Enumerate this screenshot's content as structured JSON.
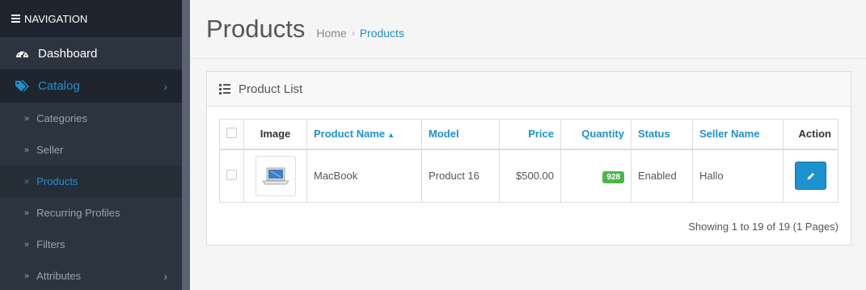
{
  "sidebar": {
    "header": "NAVIGATION",
    "dashboard": "Dashboard",
    "catalog": "Catalog",
    "items": [
      "Categories",
      "Seller",
      "Products",
      "Recurring Profiles",
      "Filters",
      "Attributes"
    ]
  },
  "header": {
    "title": "Products",
    "breadcrumb_home": "Home",
    "breadcrumb_current": "Products"
  },
  "panel": {
    "title": "Product List",
    "columns": {
      "image": "Image",
      "product_name": "Product Name",
      "model": "Model",
      "price": "Price",
      "quantity": "Quantity",
      "status": "Status",
      "seller_name": "Seller Name",
      "action": "Action"
    },
    "rows": [
      {
        "product_name": "MacBook",
        "model": "Product 16",
        "price": "$500.00",
        "quantity": "928",
        "status": "Enabled",
        "seller_name": "Hallo"
      }
    ],
    "pagination_text": "Showing 1 to 19 of 19 (1 Pages)"
  },
  "colors": {
    "accent": "#1e91cf",
    "sidebar_bg": "#2c343f",
    "quantity_badge": "#4cb64c"
  }
}
